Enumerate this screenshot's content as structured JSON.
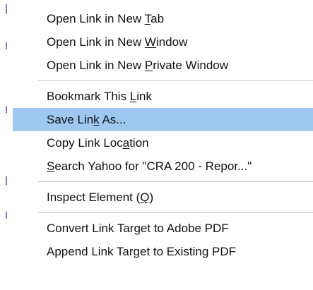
{
  "menu": {
    "groups": [
      {
        "items": [
          {
            "id": "open-new-tab",
            "before": "Open Link in New ",
            "mnemonic": "T",
            "after": "ab",
            "highlighted": false
          },
          {
            "id": "open-new-window",
            "before": "Open Link in New ",
            "mnemonic": "W",
            "after": "indow",
            "highlighted": false
          },
          {
            "id": "open-private-window",
            "before": "Open Link in New ",
            "mnemonic": "P",
            "after": "rivate Window",
            "highlighted": false
          }
        ]
      },
      {
        "items": [
          {
            "id": "bookmark-link",
            "before": "Bookmark This ",
            "mnemonic": "L",
            "after": "ink",
            "highlighted": false
          },
          {
            "id": "save-link-as",
            "before": "Save Lin",
            "mnemonic": "k",
            "after": " As...",
            "highlighted": true
          },
          {
            "id": "copy-link-location",
            "before": "Copy Link Loc",
            "mnemonic": "a",
            "after": "tion",
            "highlighted": false
          },
          {
            "id": "search-yahoo",
            "before": "",
            "mnemonic": "S",
            "after": "earch Yahoo for \"CRA 200 - Repor...\"",
            "highlighted": false
          }
        ]
      },
      {
        "items": [
          {
            "id": "inspect-element",
            "before": "Inspect Element (",
            "mnemonic": "Q",
            "after": ")",
            "highlighted": false
          }
        ]
      },
      {
        "items": [
          {
            "id": "convert-to-pdf",
            "before": "Convert Link Target to Adobe PDF",
            "mnemonic": "",
            "after": "",
            "highlighted": false
          },
          {
            "id": "append-to-pdf",
            "before": "Append Link Target to Existing PDF",
            "mnemonic": "",
            "after": "",
            "highlighted": false
          }
        ]
      }
    ]
  },
  "colors": {
    "highlight": "#9ec8f0",
    "text": "#111111",
    "separator": "#c8c8c8",
    "background": "#ffffff"
  }
}
